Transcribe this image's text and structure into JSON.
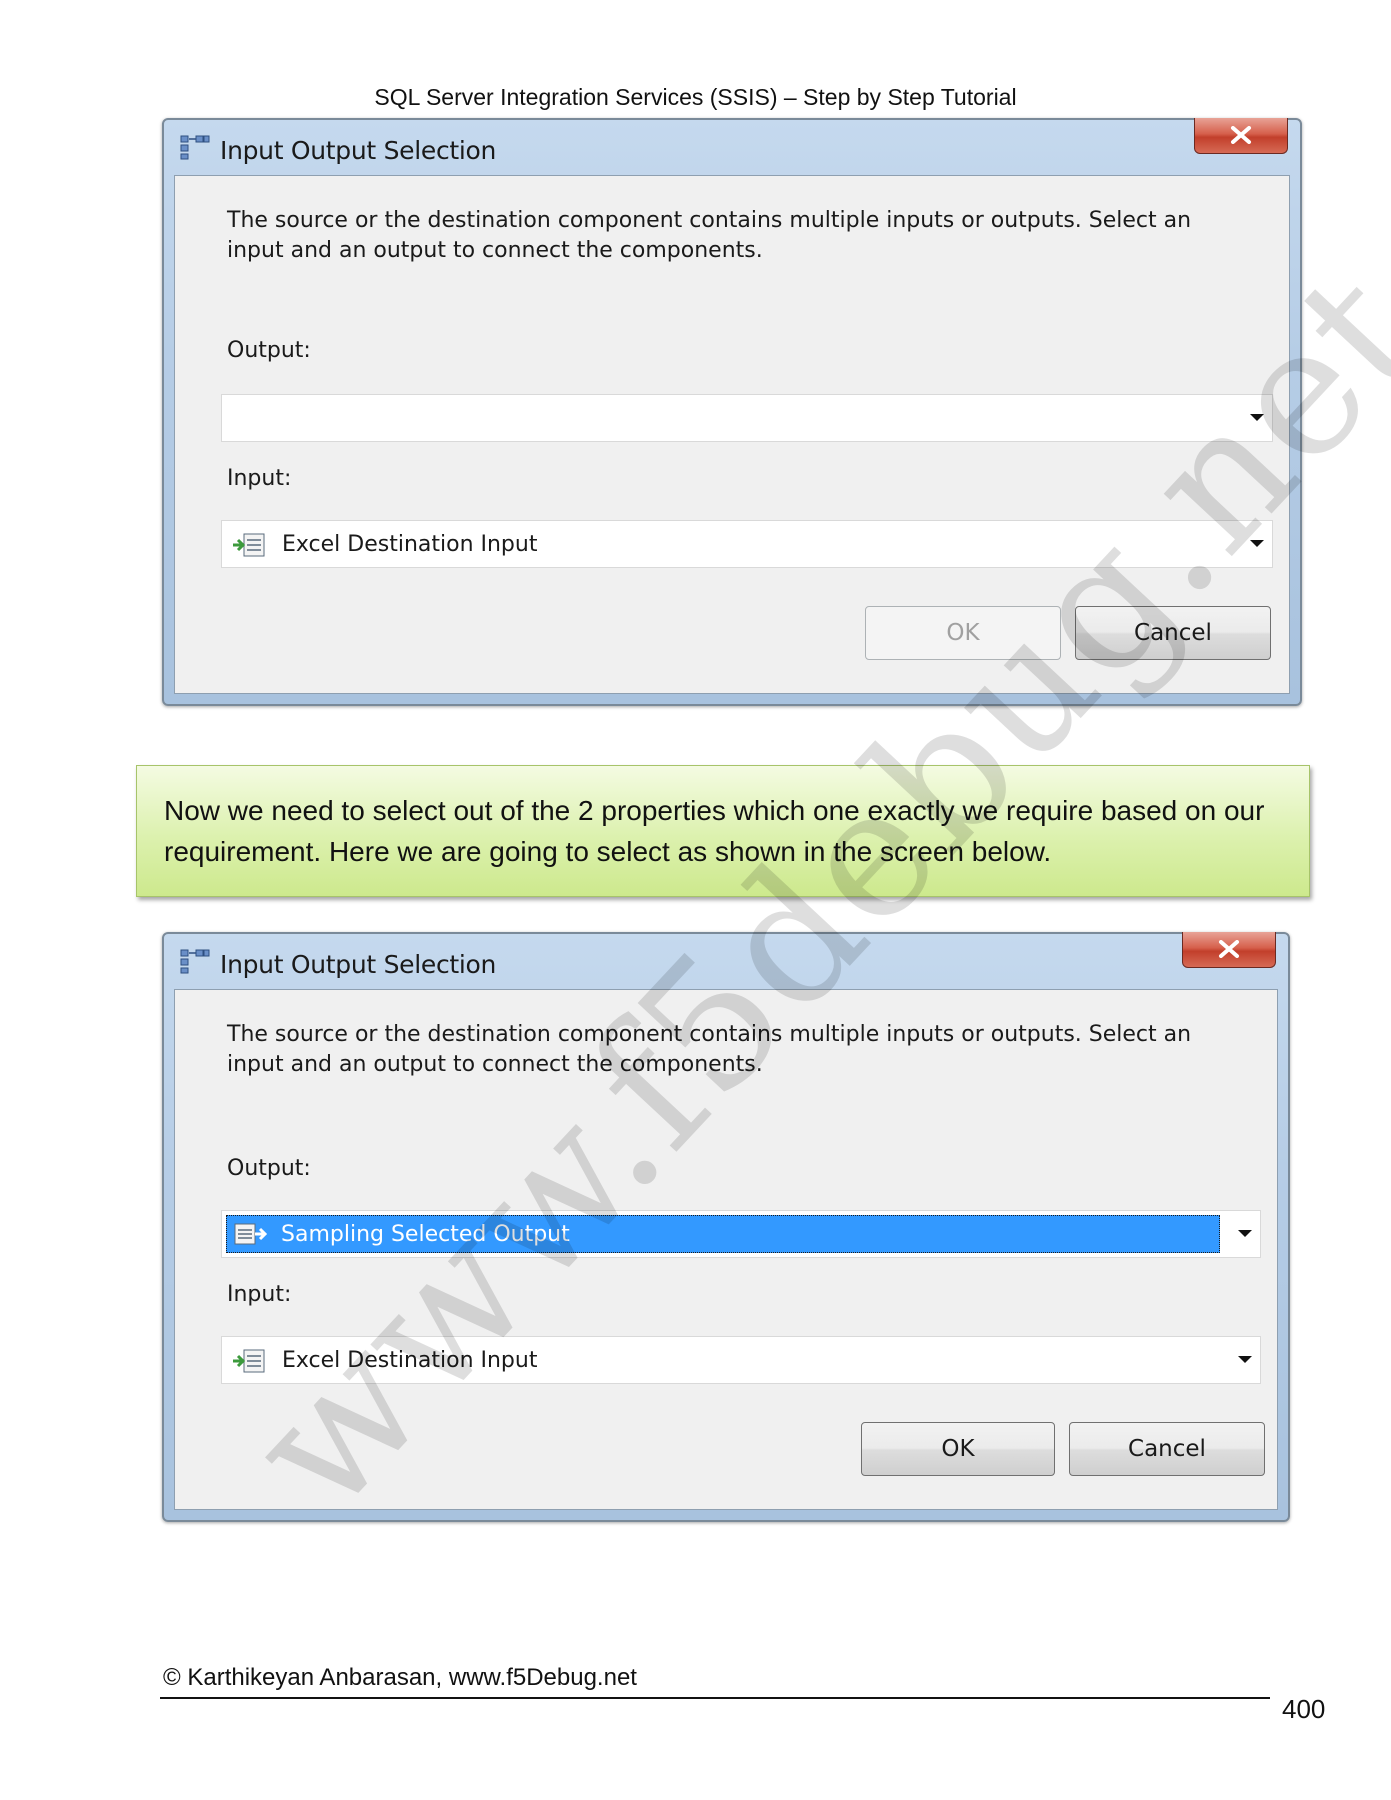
{
  "header": {
    "title": "SQL Server Integration Services (SSIS) – Step by Step Tutorial"
  },
  "dialog1": {
    "title": "Input Output Selection",
    "description": "The source or the destination component contains multiple inputs or outputs. Select an input and an output to connect the components.",
    "output_label": "Output:",
    "output_value": "",
    "input_label": "Input:",
    "input_value": "Excel Destination Input",
    "ok_label": "OK",
    "cancel_label": "Cancel"
  },
  "note": {
    "text": "Now we need to select out of the 2 properties which one exactly we require based on our requirement. Here we are going to select as shown in the screen below."
  },
  "dialog2": {
    "title": "Input Output Selection",
    "description": "The source or the destination component contains multiple inputs or outputs. Select an input and an output to connect the components.",
    "output_label": "Output:",
    "output_value": "Sampling Selected Output",
    "input_label": "Input:",
    "input_value": "Excel Destination Input",
    "ok_label": "OK",
    "cancel_label": "Cancel"
  },
  "watermark": "www.f5debug.net",
  "footer": {
    "copyright": "© Karthikeyan Anbarasan, www.f5Debug.net",
    "page_number": "400"
  },
  "colors": {
    "selection": "#3399ff",
    "close_button": "#c9432f",
    "note_background": "#dcf1ae"
  }
}
